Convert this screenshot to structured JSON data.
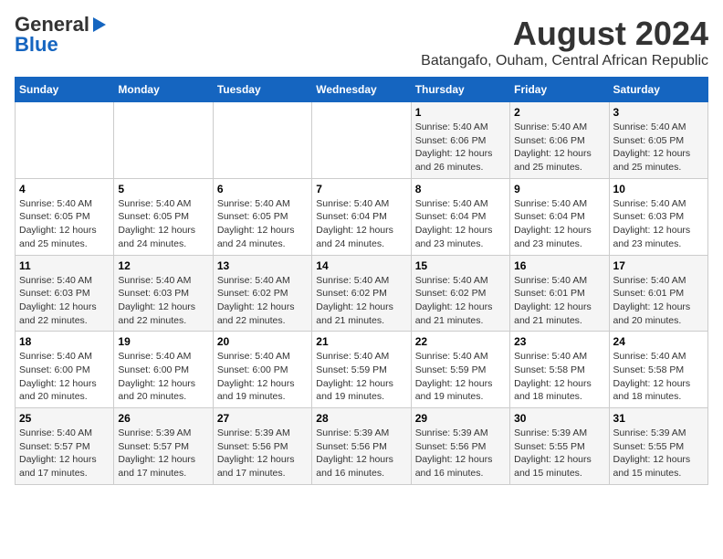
{
  "logo": {
    "general": "General",
    "blue": "Blue"
  },
  "title": "August 2024",
  "subtitle": "Batangafo, Ouham, Central African Republic",
  "days_of_week": [
    "Sunday",
    "Monday",
    "Tuesday",
    "Wednesday",
    "Thursday",
    "Friday",
    "Saturday"
  ],
  "weeks": [
    [
      {
        "day": "",
        "detail": ""
      },
      {
        "day": "",
        "detail": ""
      },
      {
        "day": "",
        "detail": ""
      },
      {
        "day": "",
        "detail": ""
      },
      {
        "day": "1",
        "detail": "Sunrise: 5:40 AM\nSunset: 6:06 PM\nDaylight: 12 hours\nand 26 minutes."
      },
      {
        "day": "2",
        "detail": "Sunrise: 5:40 AM\nSunset: 6:06 PM\nDaylight: 12 hours\nand 25 minutes."
      },
      {
        "day": "3",
        "detail": "Sunrise: 5:40 AM\nSunset: 6:05 PM\nDaylight: 12 hours\nand 25 minutes."
      }
    ],
    [
      {
        "day": "4",
        "detail": "Sunrise: 5:40 AM\nSunset: 6:05 PM\nDaylight: 12 hours\nand 25 minutes."
      },
      {
        "day": "5",
        "detail": "Sunrise: 5:40 AM\nSunset: 6:05 PM\nDaylight: 12 hours\nand 24 minutes."
      },
      {
        "day": "6",
        "detail": "Sunrise: 5:40 AM\nSunset: 6:05 PM\nDaylight: 12 hours\nand 24 minutes."
      },
      {
        "day": "7",
        "detail": "Sunrise: 5:40 AM\nSunset: 6:04 PM\nDaylight: 12 hours\nand 24 minutes."
      },
      {
        "day": "8",
        "detail": "Sunrise: 5:40 AM\nSunset: 6:04 PM\nDaylight: 12 hours\nand 23 minutes."
      },
      {
        "day": "9",
        "detail": "Sunrise: 5:40 AM\nSunset: 6:04 PM\nDaylight: 12 hours\nand 23 minutes."
      },
      {
        "day": "10",
        "detail": "Sunrise: 5:40 AM\nSunset: 6:03 PM\nDaylight: 12 hours\nand 23 minutes."
      }
    ],
    [
      {
        "day": "11",
        "detail": "Sunrise: 5:40 AM\nSunset: 6:03 PM\nDaylight: 12 hours\nand 22 minutes."
      },
      {
        "day": "12",
        "detail": "Sunrise: 5:40 AM\nSunset: 6:03 PM\nDaylight: 12 hours\nand 22 minutes."
      },
      {
        "day": "13",
        "detail": "Sunrise: 5:40 AM\nSunset: 6:02 PM\nDaylight: 12 hours\nand 22 minutes."
      },
      {
        "day": "14",
        "detail": "Sunrise: 5:40 AM\nSunset: 6:02 PM\nDaylight: 12 hours\nand 21 minutes."
      },
      {
        "day": "15",
        "detail": "Sunrise: 5:40 AM\nSunset: 6:02 PM\nDaylight: 12 hours\nand 21 minutes."
      },
      {
        "day": "16",
        "detail": "Sunrise: 5:40 AM\nSunset: 6:01 PM\nDaylight: 12 hours\nand 21 minutes."
      },
      {
        "day": "17",
        "detail": "Sunrise: 5:40 AM\nSunset: 6:01 PM\nDaylight: 12 hours\nand 20 minutes."
      }
    ],
    [
      {
        "day": "18",
        "detail": "Sunrise: 5:40 AM\nSunset: 6:00 PM\nDaylight: 12 hours\nand 20 minutes."
      },
      {
        "day": "19",
        "detail": "Sunrise: 5:40 AM\nSunset: 6:00 PM\nDaylight: 12 hours\nand 20 minutes."
      },
      {
        "day": "20",
        "detail": "Sunrise: 5:40 AM\nSunset: 6:00 PM\nDaylight: 12 hours\nand 19 minutes."
      },
      {
        "day": "21",
        "detail": "Sunrise: 5:40 AM\nSunset: 5:59 PM\nDaylight: 12 hours\nand 19 minutes."
      },
      {
        "day": "22",
        "detail": "Sunrise: 5:40 AM\nSunset: 5:59 PM\nDaylight: 12 hours\nand 19 minutes."
      },
      {
        "day": "23",
        "detail": "Sunrise: 5:40 AM\nSunset: 5:58 PM\nDaylight: 12 hours\nand 18 minutes."
      },
      {
        "day": "24",
        "detail": "Sunrise: 5:40 AM\nSunset: 5:58 PM\nDaylight: 12 hours\nand 18 minutes."
      }
    ],
    [
      {
        "day": "25",
        "detail": "Sunrise: 5:40 AM\nSunset: 5:57 PM\nDaylight: 12 hours\nand 17 minutes."
      },
      {
        "day": "26",
        "detail": "Sunrise: 5:39 AM\nSunset: 5:57 PM\nDaylight: 12 hours\nand 17 minutes."
      },
      {
        "day": "27",
        "detail": "Sunrise: 5:39 AM\nSunset: 5:56 PM\nDaylight: 12 hours\nand 17 minutes."
      },
      {
        "day": "28",
        "detail": "Sunrise: 5:39 AM\nSunset: 5:56 PM\nDaylight: 12 hours\nand 16 minutes."
      },
      {
        "day": "29",
        "detail": "Sunrise: 5:39 AM\nSunset: 5:56 PM\nDaylight: 12 hours\nand 16 minutes."
      },
      {
        "day": "30",
        "detail": "Sunrise: 5:39 AM\nSunset: 5:55 PM\nDaylight: 12 hours\nand 15 minutes."
      },
      {
        "day": "31",
        "detail": "Sunrise: 5:39 AM\nSunset: 5:55 PM\nDaylight: 12 hours\nand 15 minutes."
      }
    ]
  ]
}
